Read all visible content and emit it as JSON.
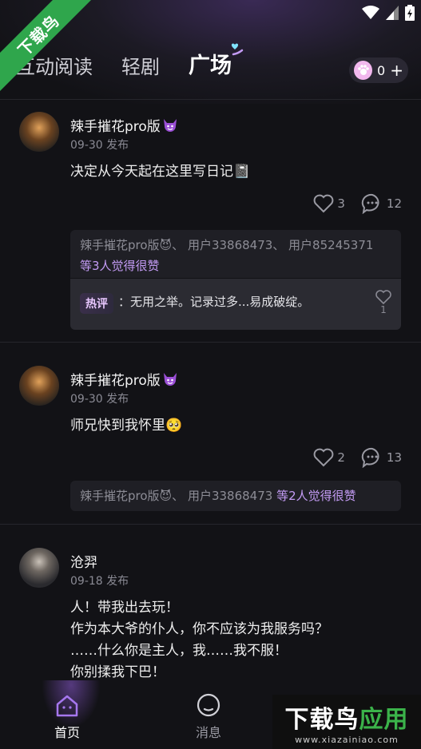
{
  "corner_ribbon": "下载鸟",
  "tabs": [
    {
      "label": "互动阅读"
    },
    {
      "label": "轻剧"
    },
    {
      "label": "广场"
    }
  ],
  "coins": {
    "count": "0",
    "plus": "+"
  },
  "posts": [
    {
      "author": "辣手摧花pro版",
      "date": "09-30 发布",
      "content": "决定从今天起在这里写日记📓",
      "likes": "3",
      "comments": "12",
      "liked_by": "辣手摧花pro版😈、 用户33868473、 用户85245371",
      "liked_by_suffix": "等3人觉得很赞",
      "hot_tag": "热评",
      "hot_comment": "：无用之举。记录过多...易成破绽。",
      "hot_likes": "1"
    },
    {
      "author": "辣手摧花pro版",
      "date": "09-30 发布",
      "content": "师兄快到我怀里🥺",
      "likes": "2",
      "comments": "13",
      "liked_by": "辣手摧花pro版😈、 用户33868473",
      "liked_by_suffix": " 等2人觉得很赞"
    },
    {
      "author": "沧羿",
      "date": "09-18 发布",
      "content_lines": [
        "人！带我出去玩！",
        "作为本大爷的仆人，你不应该为我服务吗？",
        "……什么你是主人，我……我不服！",
        "你别揉我下巴！"
      ]
    }
  ],
  "bottom_nav": [
    {
      "label": "首页",
      "icon": "home-icon"
    },
    {
      "label": "消息",
      "icon": "message-icon"
    }
  ],
  "watermark": {
    "title_a": "下载鸟",
    "title_b": "应用",
    "url": "www.xiazainiao.com"
  },
  "colors": {
    "accent_purple": "#c39bf4",
    "background": "#121216",
    "ribbon_green": "#2fa64c"
  }
}
